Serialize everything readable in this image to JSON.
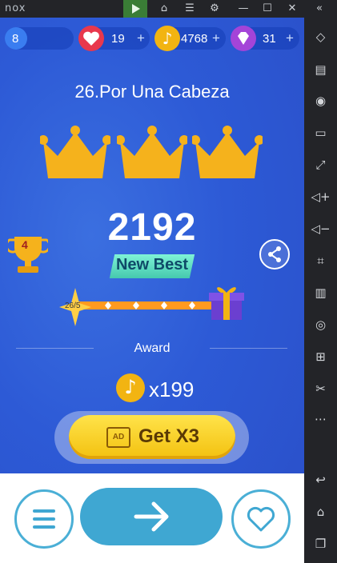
{
  "emulator": {
    "brand": "nox",
    "titlebar_icons": [
      "play-store-icon",
      "app-center-icon",
      "menu-icon",
      "settings-icon",
      "minimize-icon",
      "maximize-icon",
      "close-icon",
      "collapse-sidebar-icon"
    ],
    "sidebar_icons": [
      "keyboard-mapping-icon",
      "script-icon",
      "location-icon",
      "screen-icon",
      "fullscreen-icon",
      "volume-up-icon",
      "volume-down-icon",
      "screenshot-icon",
      "multi-instance-icon",
      "shake-icon",
      "apk-install-icon",
      "cut-icon",
      "more-icon",
      "back-icon",
      "home-icon",
      "recent-apps-icon"
    ]
  },
  "hud": {
    "level": "8",
    "lives": "19",
    "coins": "4768",
    "gems": "31",
    "plus": "+"
  },
  "result": {
    "song_title": "26.Por Una Cabeza",
    "crowns": 3,
    "score": "2192",
    "new_best_label": "New Best",
    "trophy_rank": "4",
    "progress_label": "26/5",
    "progress_fraction": 1.0,
    "award_label": "Award",
    "award_amount": "x199",
    "cta_label": "Get X3",
    "ad_label": "AD"
  },
  "colors": {
    "background": "#2d5ad6",
    "crown": "#f5b21c",
    "cta": "#f6c81a",
    "accent": "#3fa7d2",
    "heart": "#e8384d",
    "gem": "#a444d8"
  }
}
